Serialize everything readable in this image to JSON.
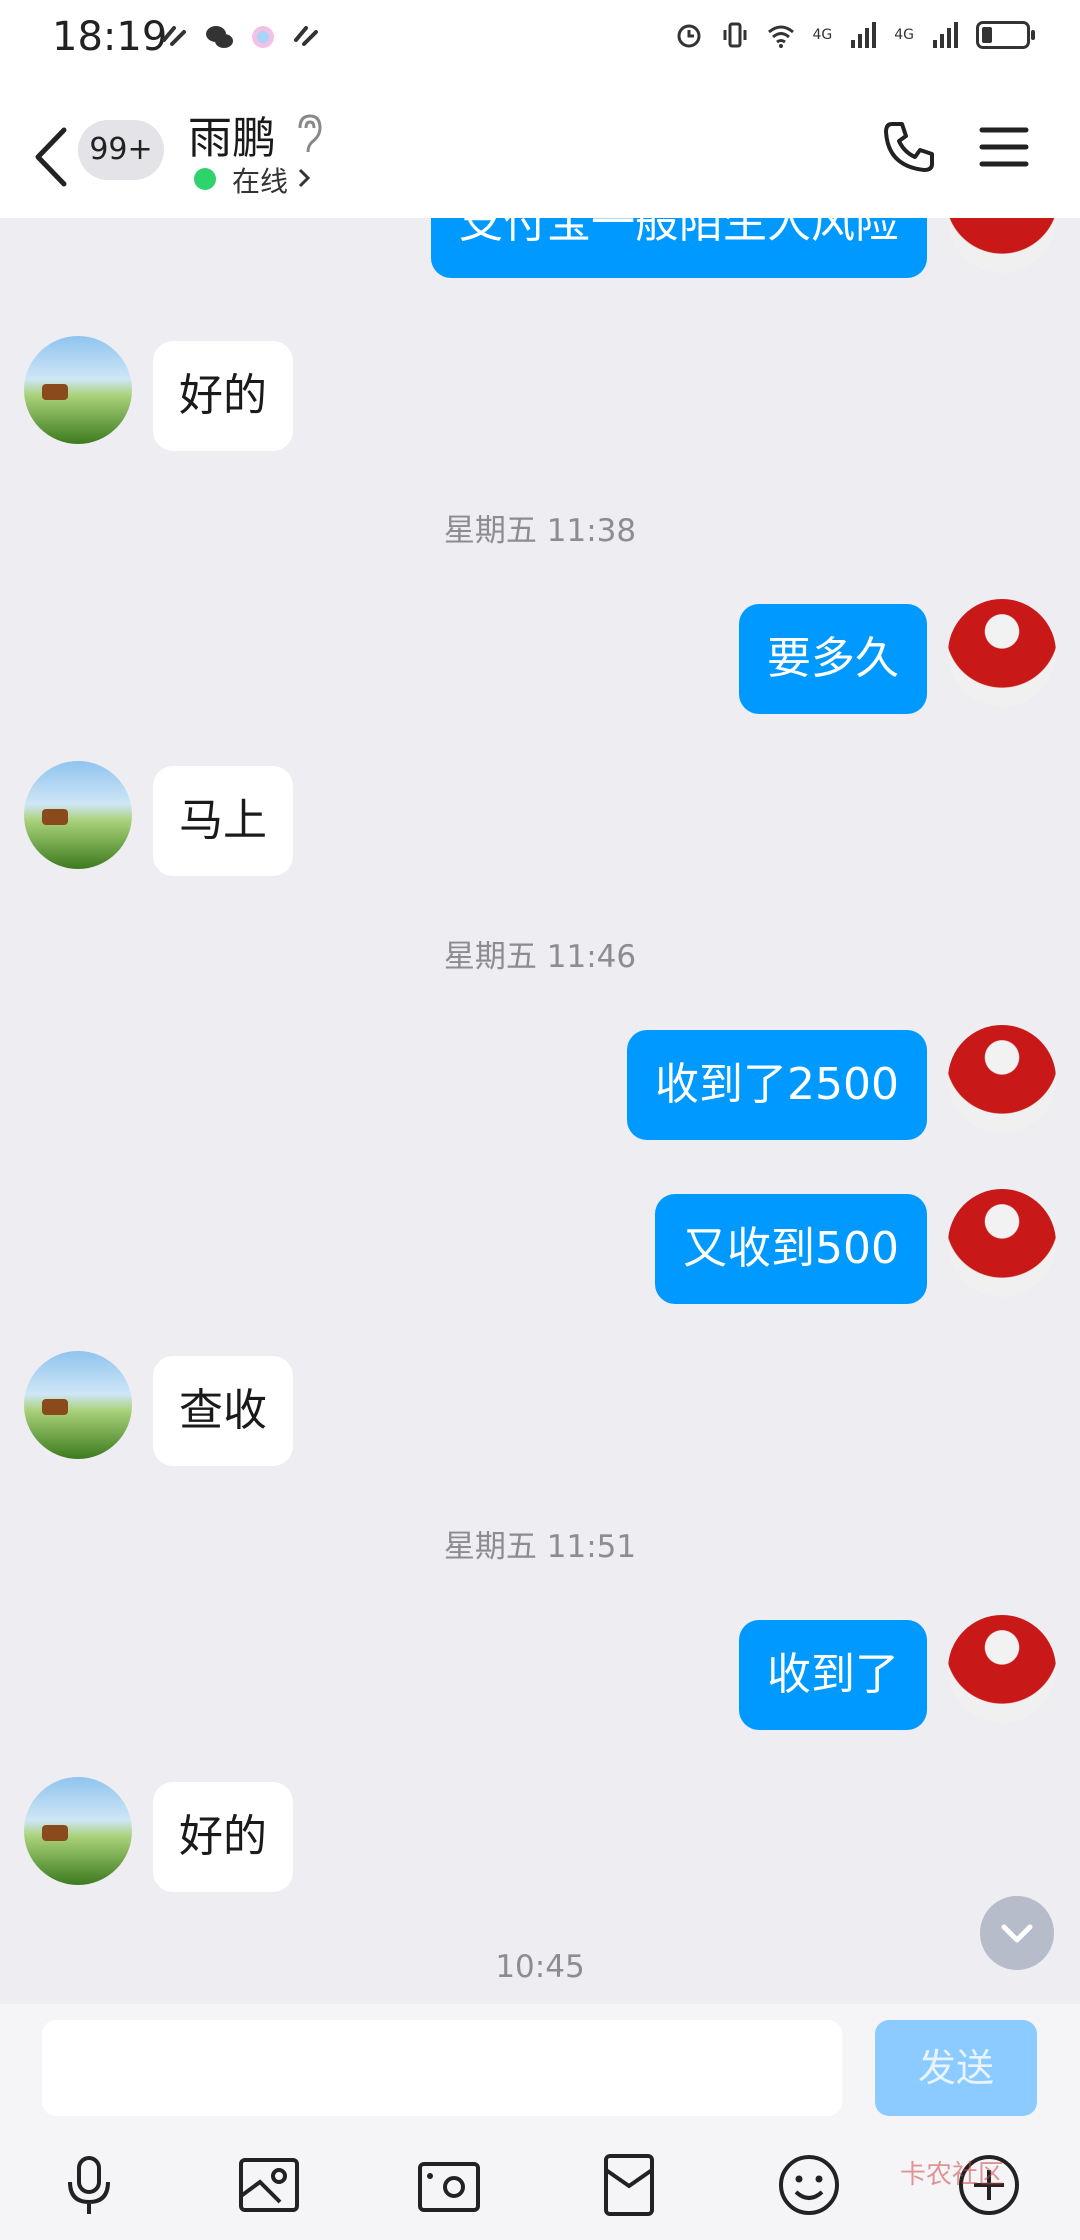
{
  "status": {
    "time": "18:19",
    "network_1": "4G",
    "network_2": "4G"
  },
  "header": {
    "unread_badge": "99+",
    "contact_name": "雨鹏",
    "online_status": "在线"
  },
  "messages": [
    {
      "side": "out",
      "text": "支付宝一般陌生人风险"
    },
    {
      "side": "in",
      "text": "好的"
    },
    {
      "timestamp": "星期五 11:38"
    },
    {
      "side": "out",
      "text": "要多久"
    },
    {
      "side": "in",
      "text": "马上"
    },
    {
      "timestamp": "星期五 11:46"
    },
    {
      "side": "out",
      "text": "收到了2500"
    },
    {
      "side": "out",
      "text": "又收到500"
    },
    {
      "side": "in",
      "text": "查收"
    },
    {
      "timestamp": "星期五 11:51"
    },
    {
      "side": "out",
      "text": "收到了"
    },
    {
      "side": "in",
      "text": "好的"
    },
    {
      "timestamp": "10:45"
    }
  ],
  "input": {
    "placeholder": "",
    "send_label": "发送"
  },
  "toolbar": [
    "microphone-icon",
    "image-icon",
    "camera-icon",
    "red-packet-icon",
    "emoji-icon",
    "plus-icon"
  ],
  "watermark": "卡农社区",
  "colors": {
    "outgoing_bubble": "#0099ff",
    "incoming_bubble": "#ffffff",
    "background": "#ededf2",
    "online_dot": "#2fd36b",
    "send_button": "#8ccbff"
  }
}
